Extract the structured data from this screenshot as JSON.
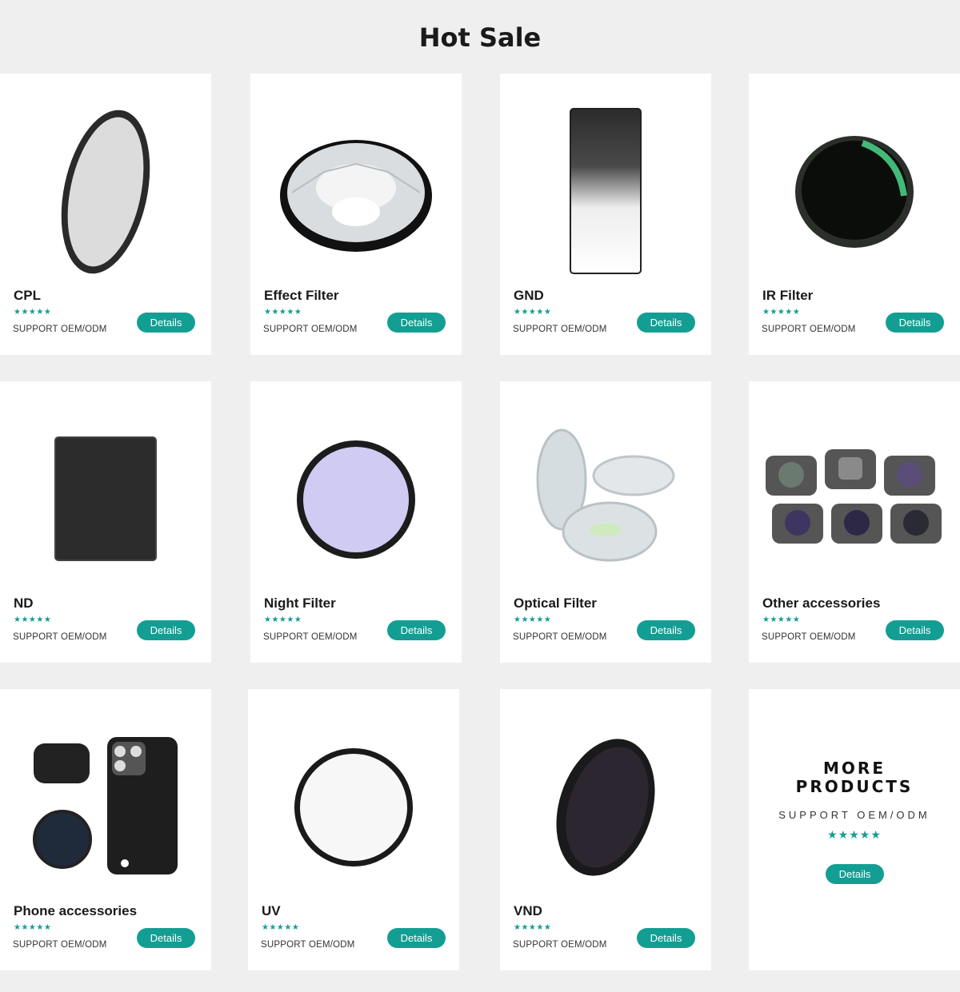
{
  "page": {
    "title": "Hot Sale"
  },
  "colors": {
    "accent": "#139e93",
    "background": "#efefef",
    "card": "#ffffff"
  },
  "products": [
    {
      "name": "CPL",
      "stars": "★★★★★",
      "support": "SUPPORT OEM/ODM",
      "button": "Details",
      "icon": "cpl-filter-icon"
    },
    {
      "name": "Effect Filter",
      "stars": "★★★★★",
      "support": "SUPPORT OEM/ODM",
      "button": "Details",
      "icon": "effect-filter-icon"
    },
    {
      "name": "GND",
      "stars": "★★★★★",
      "support": "SUPPORT OEM/ODM",
      "button": "Details",
      "icon": "gnd-filter-icon"
    },
    {
      "name": "IR Filter",
      "stars": "★★★★★",
      "support": "SUPPORT OEM/ODM",
      "button": "Details",
      "icon": "ir-filter-icon"
    },
    {
      "name": "ND",
      "stars": "★★★★★",
      "support": "SUPPORT OEM/ODM",
      "button": "Details",
      "icon": "nd-filter-icon"
    },
    {
      "name": "Night Filter",
      "stars": "★★★★★",
      "support": "SUPPORT OEM/ODM",
      "button": "Details",
      "icon": "night-filter-icon"
    },
    {
      "name": "Optical Filter",
      "stars": "★★★★★",
      "support": "SUPPORT OEM/ODM",
      "button": "Details",
      "icon": "optical-filter-icon"
    },
    {
      "name": "Other accessories",
      "stars": "★★★★★",
      "support": "SUPPORT OEM/ODM",
      "button": "Details",
      "icon": "drone-filters-icon"
    },
    {
      "name": "Phone accessories",
      "stars": "★★★★★",
      "support": "SUPPORT OEM/ODM",
      "button": "Details",
      "icon": "phone-case-icon"
    },
    {
      "name": "UV",
      "stars": "★★★★★",
      "support": "SUPPORT OEM/ODM",
      "button": "Details",
      "icon": "uv-filter-icon"
    },
    {
      "name": "VND",
      "stars": "★★★★★",
      "support": "SUPPORT OEM/ODM",
      "button": "Details",
      "icon": "vnd-filter-icon"
    }
  ],
  "more": {
    "title": "MORE\nPRODUCTS",
    "support": "SUPPORT OEM/ODM",
    "stars": "★★★★★",
    "button": "Details"
  }
}
